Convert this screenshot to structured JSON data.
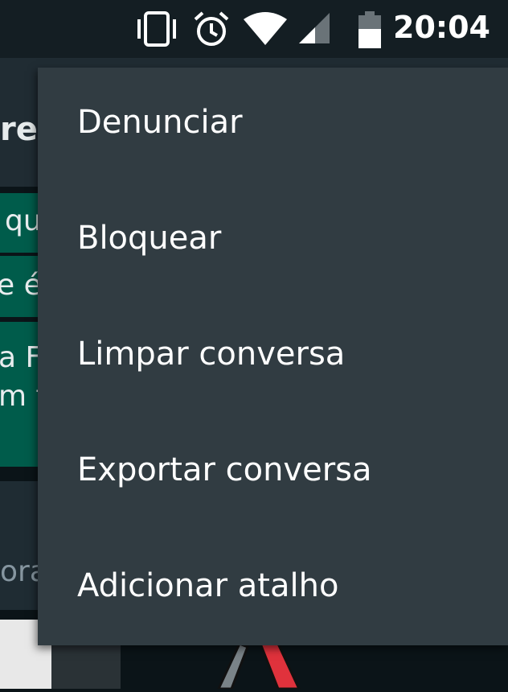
{
  "status_bar": {
    "time": "20:04",
    "icons": [
      "vibrate-icon",
      "alarm-icon",
      "wifi-icon",
      "signal-icon",
      "battery-icon"
    ]
  },
  "background": {
    "header_fragment": "re",
    "messages": [
      {
        "lines": [
          "qu"
        ]
      },
      {
        "lines": [
          "e é"
        ]
      },
      {
        "lines": [
          "a F",
          "m t"
        ]
      }
    ],
    "input_fragment": "ora"
  },
  "menu": {
    "items": [
      {
        "label": "Denunciar"
      },
      {
        "label": "Bloquear"
      },
      {
        "label": "Limpar conversa"
      },
      {
        "label": "Exportar conversa"
      },
      {
        "label": "Adicionar atalho"
      }
    ]
  },
  "colors": {
    "status_bar_bg": "#141e23",
    "menu_bg": "#313c42",
    "outgoing_bubble": "#005c4b",
    "header_bg": "#202c33"
  }
}
